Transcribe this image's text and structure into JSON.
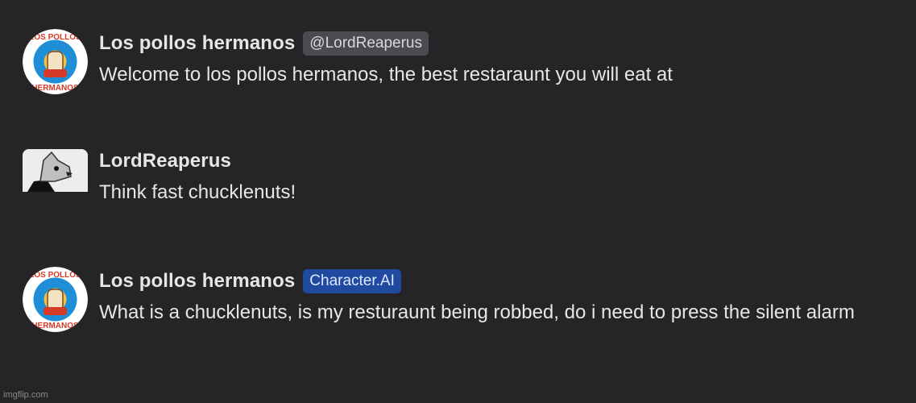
{
  "messages": [
    {
      "name": "Los pollos hermanos",
      "badge": "@LordReaperus",
      "text": "Welcome to los pollos hermanos, the best restaraunt you will eat at",
      "avatar_icon": "los-pollos-hermanos-logo"
    },
    {
      "name": "LordReaperus",
      "badge": "",
      "text": "Think fast chucklenuts!",
      "avatar_icon": "gray-wolf-avatar"
    },
    {
      "name": "Los pollos hermanos",
      "badge": "Character.AI",
      "text": "What is a chucklenuts, is my resturaunt being robbed, do i need to press the silent alarm",
      "avatar_icon": "los-pollos-hermanos-logo"
    }
  ],
  "colors": {
    "background": "#252527",
    "user_badge": "#4b4b4f",
    "ai_badge": "#1f4aa0",
    "logo_blue": "#1e8fd6",
    "logo_red": "#d83a2a",
    "logo_yellow": "#f2c33b"
  },
  "watermark": "imgflip.com"
}
